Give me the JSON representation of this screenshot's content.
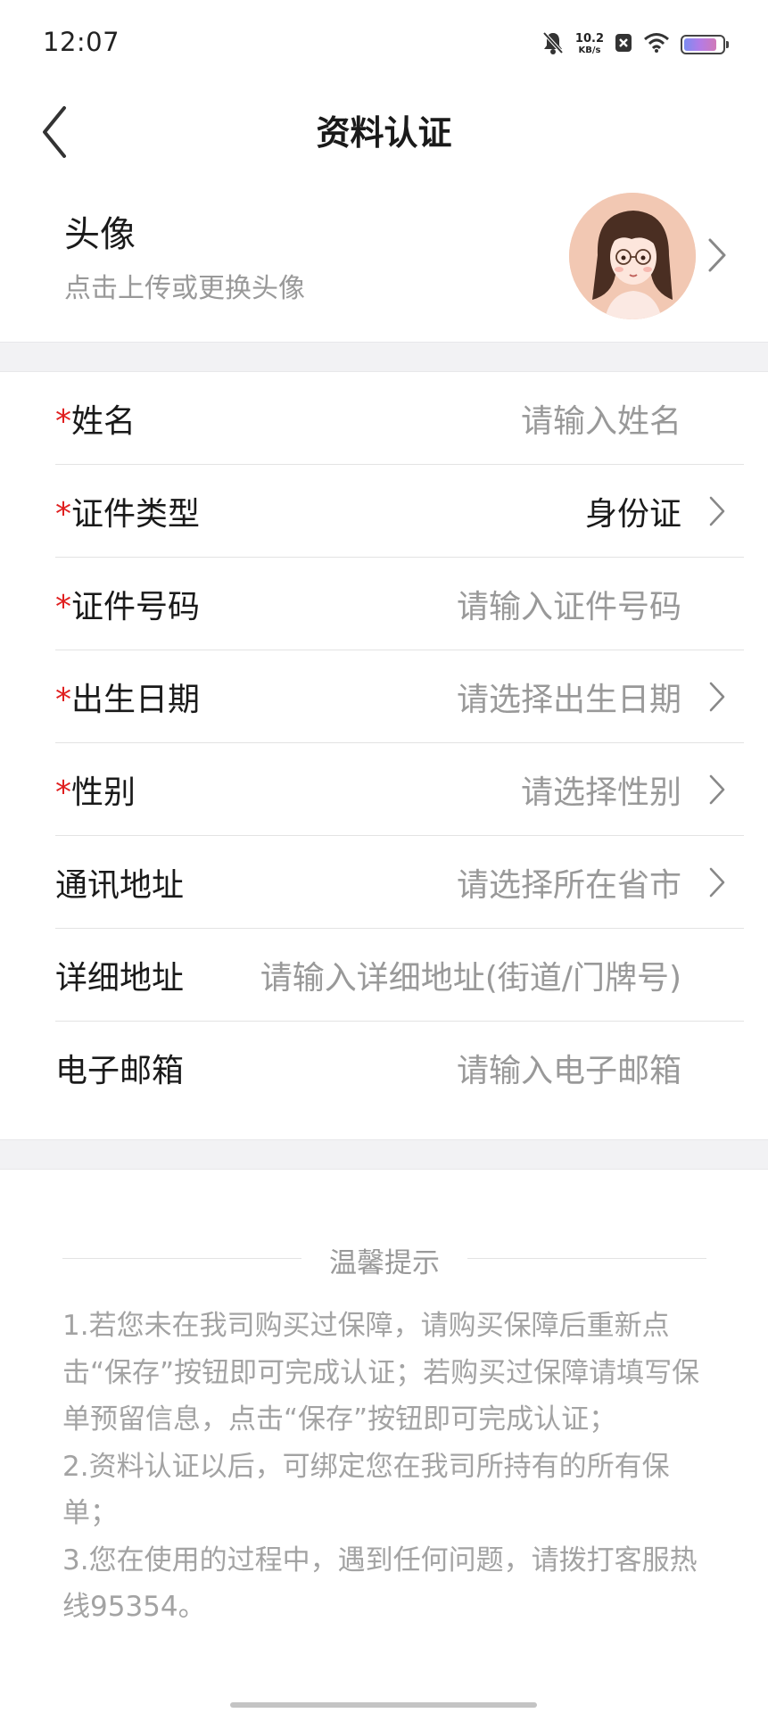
{
  "status_bar": {
    "time": "12:07",
    "net_speed_value": "10.2",
    "net_speed_unit": "KB/s",
    "icons": [
      "mute-bell-icon",
      "close-notification-icon",
      "wifi-icon",
      "battery-icon"
    ],
    "battery_level": 0.85
  },
  "header": {
    "title": "资料认证",
    "back_icon": "chevron-left-icon"
  },
  "avatar_section": {
    "label": "头像",
    "hint": "点击上传或更换头像"
  },
  "form": {
    "rows": [
      {
        "required": true,
        "label": "姓名",
        "value": "请输入姓名",
        "is_placeholder": true,
        "has_chevron": false
      },
      {
        "required": true,
        "label": "证件类型",
        "value": "身份证",
        "is_placeholder": false,
        "has_chevron": true
      },
      {
        "required": true,
        "label": "证件号码",
        "value": "请输入证件号码",
        "is_placeholder": true,
        "has_chevron": false
      },
      {
        "required": true,
        "label": "出生日期",
        "value": "请选择出生日期",
        "is_placeholder": true,
        "has_chevron": true
      },
      {
        "required": true,
        "label": "性别",
        "value": "请选择性别",
        "is_placeholder": true,
        "has_chevron": true
      },
      {
        "required": false,
        "label": "通讯地址",
        "value": "请选择所在省市",
        "is_placeholder": true,
        "has_chevron": true
      },
      {
        "required": false,
        "label": "详细地址",
        "value": "请输入详细地址(街道/门牌号)",
        "is_placeholder": true,
        "has_chevron": false
      },
      {
        "required": false,
        "label": "电子邮箱",
        "value": "请输入电子邮箱",
        "is_placeholder": true,
        "has_chevron": false
      }
    ],
    "required_mark": "*"
  },
  "tips": {
    "title": "温馨提示",
    "lines": [
      "1.若您未在我司购买过保障，请购买保障后重新点击“保存”按钮即可完成认证；若购买过保障请填写保单预留信息，点击“保存”按钮即可完成认证；",
      "2.资料认证以后，可绑定您在我司所持有的所有保单；",
      "3.您在使用的过程中，遇到任何问题，请拨打客服热线95354。"
    ]
  },
  "colors": {
    "required_star": "#e02020",
    "placeholder": "#999999",
    "text": "#1a1a1a",
    "section_gap": "#f2f2f4"
  }
}
